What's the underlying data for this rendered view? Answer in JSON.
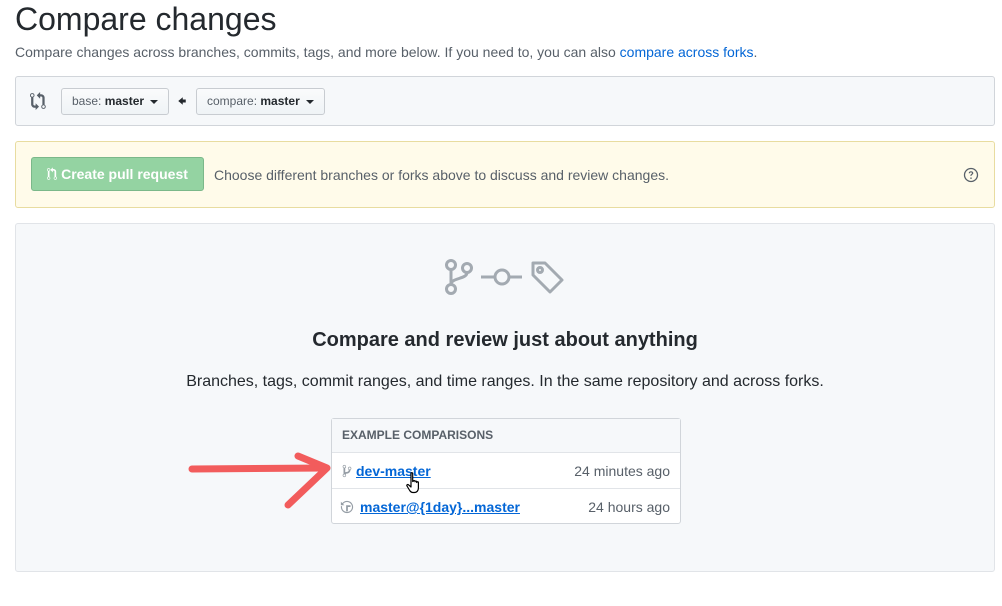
{
  "header": {
    "title": "Compare changes",
    "subtitle_prefix": "Compare changes across branches, commits, tags, and more below. If you need to, you can also ",
    "subtitle_link": "compare across forks",
    "subtitle_suffix": "."
  },
  "range": {
    "base_prefix": "base:",
    "base_branch": "master",
    "compare_prefix": "compare:",
    "compare_branch": "master"
  },
  "flash": {
    "button_label": "Create pull request",
    "message": "Choose different branches or forks above to discuss and review changes."
  },
  "blankslate": {
    "icons": [
      "git-branch-icon",
      "git-commit-icon",
      "tag-icon"
    ],
    "title": "Compare and review just about anything",
    "description": "Branches, tags, commit ranges, and time ranges. In the same repository and across forks."
  },
  "examples": {
    "header": "EXAMPLE COMPARISONS",
    "items": [
      {
        "icon": "git-branch-icon",
        "label": "dev-master",
        "time": "24 minutes ago"
      },
      {
        "icon": "history-icon",
        "label": "master@{1day}...master",
        "time": "24 hours ago"
      }
    ]
  },
  "colors": {
    "link": "#0366d6",
    "pr_button": "#94d3a2",
    "flash_bg": "#fffbea",
    "annotation_arrow": "#f25c5c"
  }
}
